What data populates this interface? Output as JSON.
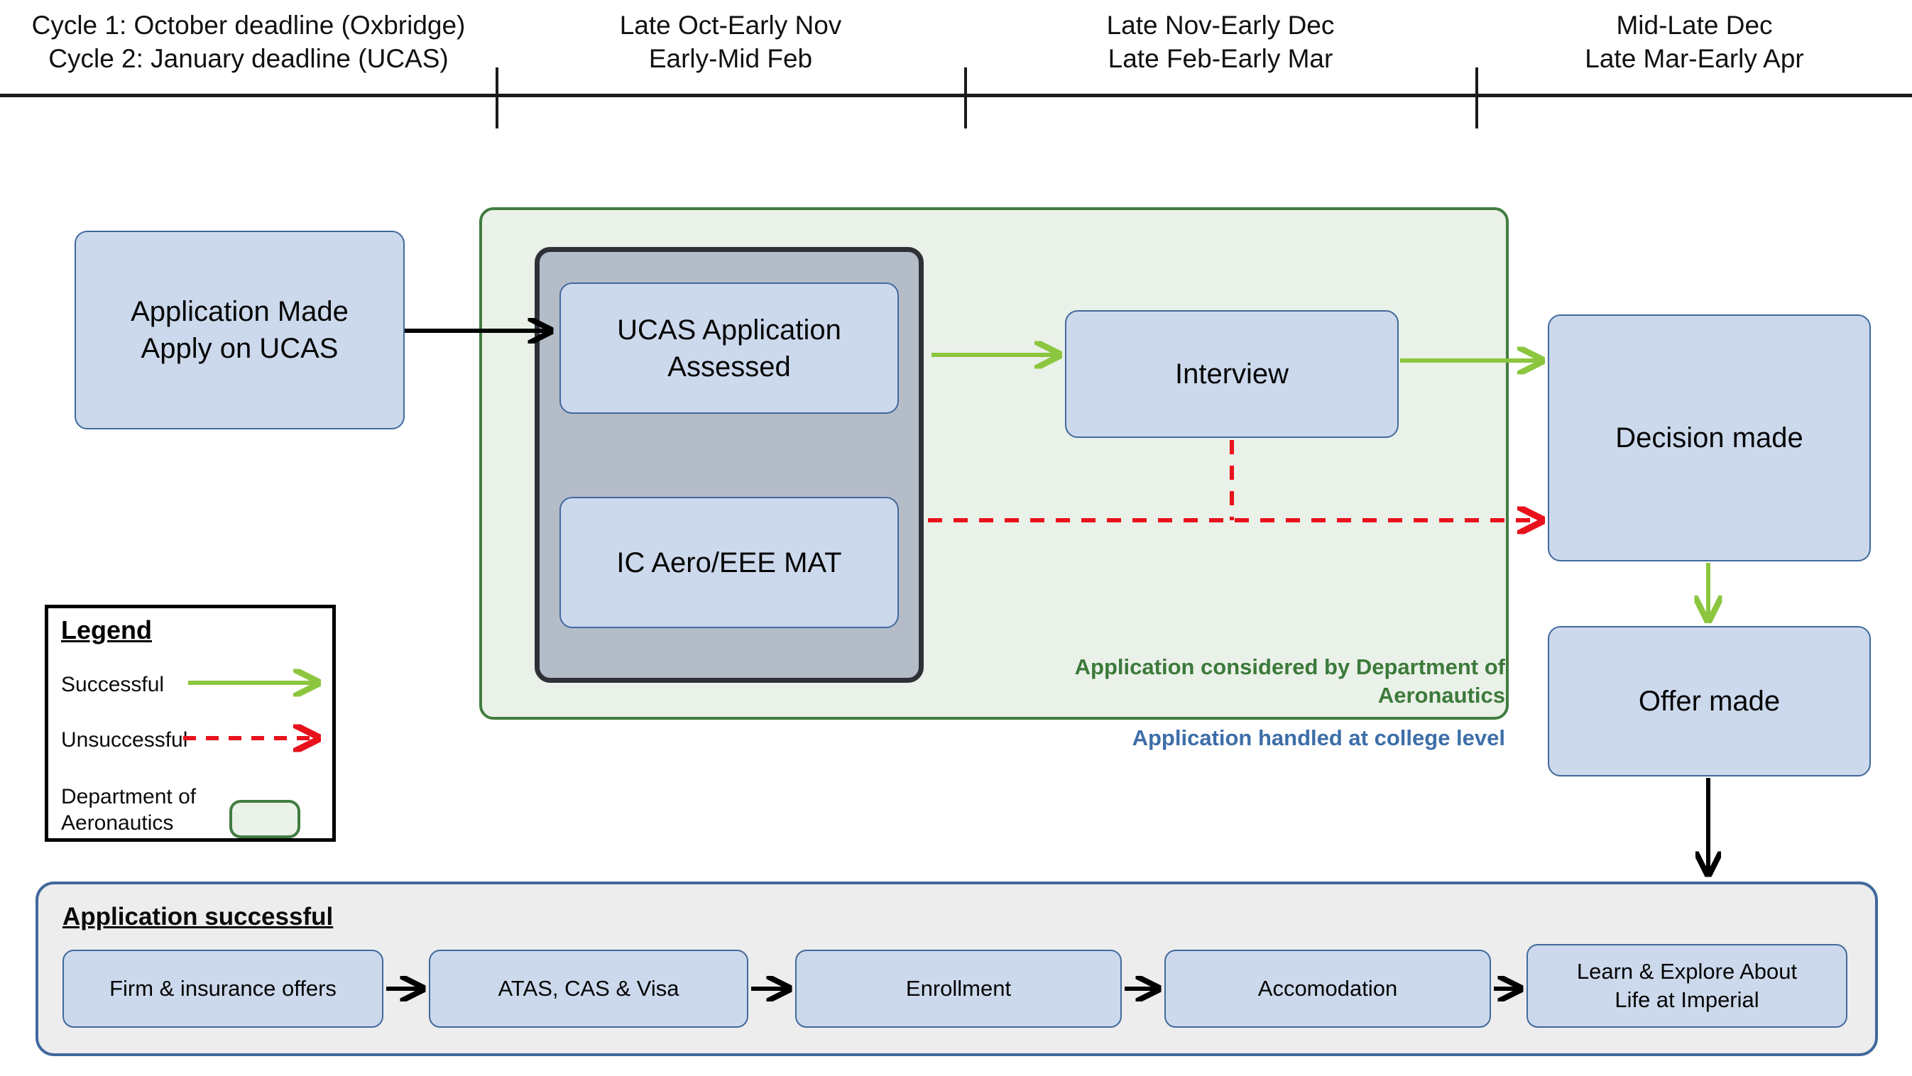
{
  "timeline": {
    "periods": [
      {
        "line1": "Cycle 1: October deadline (Oxbridge)",
        "line2": "Cycle 2: January deadline (UCAS)"
      },
      {
        "line1": "Late Oct-Early Nov",
        "line2": "Early-Mid Feb"
      },
      {
        "line1": "Late Nov-Early Dec",
        "line2": "Late Feb-Early Mar"
      },
      {
        "line1": "Mid-Late Dec",
        "line2": "Late Mar-Early Apr"
      }
    ]
  },
  "nodes": {
    "application_made": {
      "line1": "Application Made",
      "line2": "Apply on UCAS"
    },
    "ucas_assessed": {
      "line1": "UCAS Application",
      "line2": "Assessed"
    },
    "mat": {
      "line1": "IC Aero/EEE MAT"
    },
    "interview": {
      "line1": "Interview"
    },
    "decision_made": {
      "line1": "Decision made"
    },
    "offer_made": {
      "line1": "Offer made"
    }
  },
  "annotations": {
    "dept_note_line1": "Application considered by",
    "dept_note_line2": "Department of Aeronautics",
    "college_note": "Application handled at college level"
  },
  "legend": {
    "title": "Legend",
    "successful_label": "Successful",
    "unsuccessful_label": "Unsuccessful",
    "department_label_line1": "Department of",
    "department_label_line2": "Aeronautics"
  },
  "success_panel": {
    "title": "Application successful",
    "steps": [
      {
        "line1": "Firm & insurance offers"
      },
      {
        "line1": "ATAS, CAS & Visa"
      },
      {
        "line1": "Enrollment"
      },
      {
        "line1": "Accomodation"
      },
      {
        "line1": "Learn & Explore About",
        "line2": "Life at Imperial"
      }
    ]
  },
  "colors": {
    "node_fill": "#ccd9ec",
    "node_stroke": "#41699c",
    "dept_fill": "#eaf1e8",
    "dept_stroke": "#417c40",
    "assess_fill": "#b4bcc8",
    "assess_stroke": "#2d3137",
    "successful_arrow": "#8cc63f",
    "unsuccessful_arrow": "#e8121c",
    "plain_arrow": "#000000",
    "college_text": "#3d6ea8",
    "dept_text": "#3c7a3b"
  }
}
